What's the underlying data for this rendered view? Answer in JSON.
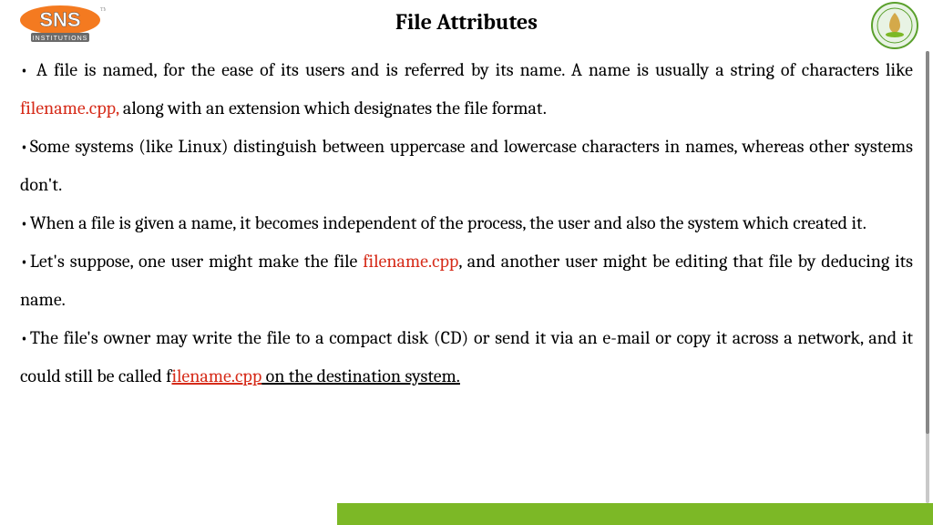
{
  "title": "File Attributes",
  "bullets": {
    "b1_a": " A file is named, for the ease of its users and is referred by its name. A name is usually a string of characters like ",
    "b1_red": "filename.cpp,",
    "b1_b": " along with an extension which designates the file format.",
    "b2": "Some systems (like Linux) distinguish between uppercase and lowercase characters in names, whereas other systems don't.",
    "b3": "When a file is given a name, it becomes independent of the process, the user and also the system which created it.",
    "b4_a": "Let's suppose, one user might make the file ",
    "b4_red": "filename.cpp",
    "b4_b": ", and another user might be editing that file by deducing its name.",
    "b5_a": "The file's owner may write the file to a compact disk (CD) or send it via an e-mail or copy it across a network, and it could still be called f",
    "b5_red": "ilename.cpp",
    "b5_b": " on the destination system."
  }
}
